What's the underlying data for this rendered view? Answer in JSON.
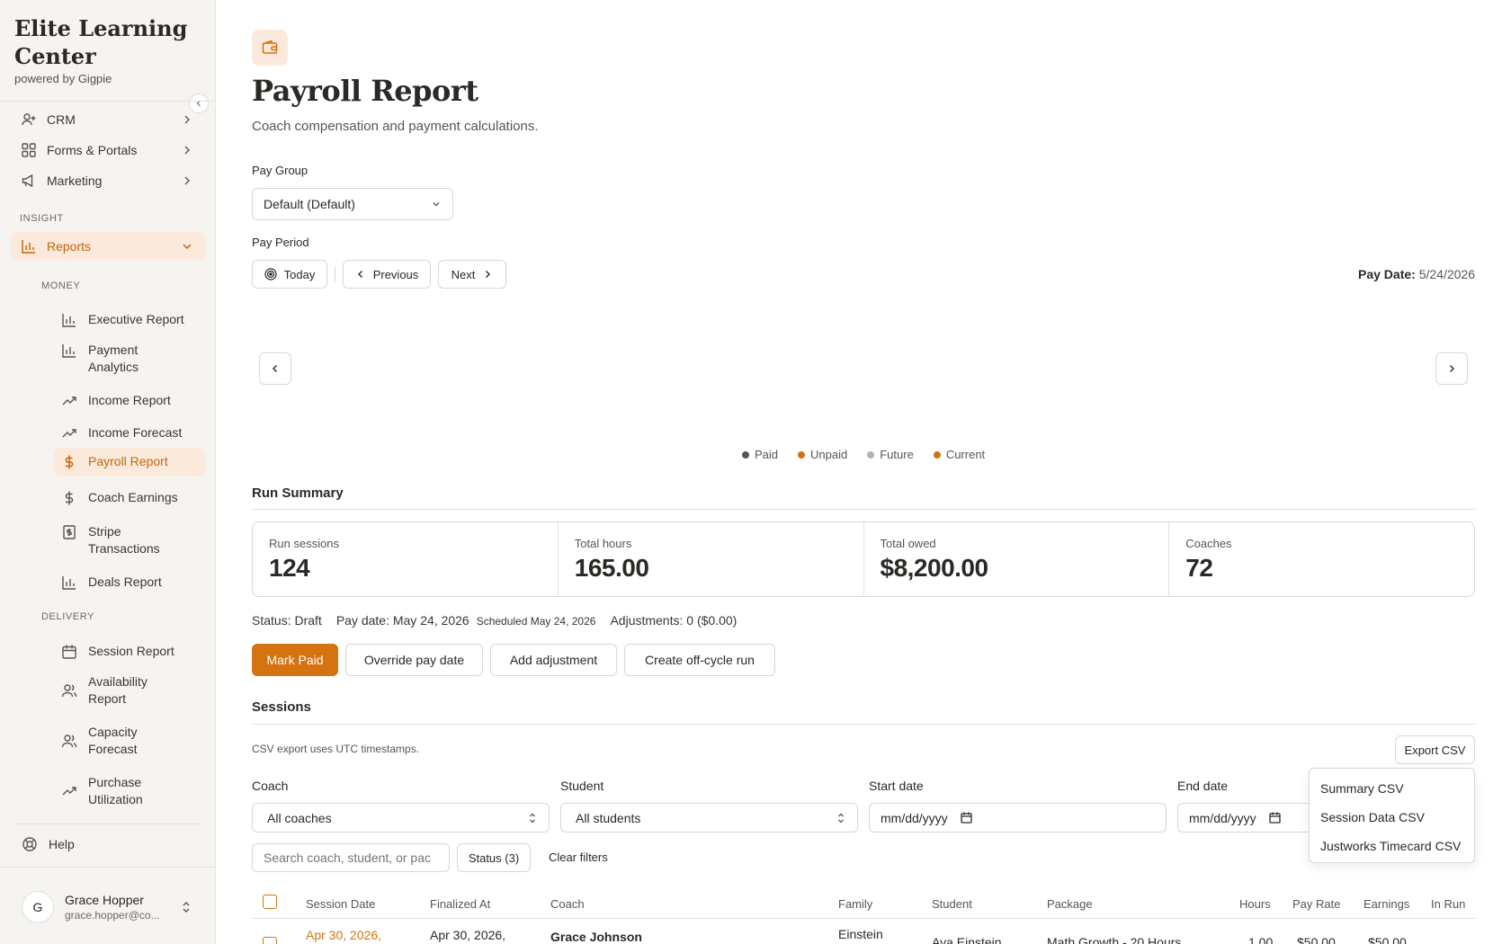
{
  "brand": {
    "name": "Elite Learning Center",
    "powered_by": "powered by Gigpie"
  },
  "nav": {
    "top_items": [
      {
        "label": "CRM",
        "icon": "user-plus-icon"
      },
      {
        "label": "Forms & Portals",
        "icon": "grid-icon"
      },
      {
        "label": "Marketing",
        "icon": "megaphone-icon"
      }
    ],
    "insight_label": "INSIGHT",
    "reports_label": "Reports",
    "money_label": "MONEY",
    "money_items": [
      {
        "label": "Executive Report",
        "icon": "bar-chart-icon"
      },
      {
        "label": "Payment Analytics",
        "icon": "bar-chart-icon"
      },
      {
        "label": "Income Report",
        "icon": "trending-up-icon"
      },
      {
        "label": "Income Forecast",
        "icon": "trending-up-icon"
      },
      {
        "label": "Payroll Report",
        "icon": "dollar-icon",
        "active": true
      },
      {
        "label": "Coach Earnings",
        "icon": "dollar-icon"
      },
      {
        "label": "Stripe Transactions",
        "icon": "receipt-icon"
      },
      {
        "label": "Deals Report",
        "icon": "bar-chart-icon"
      }
    ],
    "delivery_label": "DELIVERY",
    "delivery_items": [
      {
        "label": "Session Report",
        "icon": "calendar-icon"
      },
      {
        "label": "Availability Report",
        "icon": "users-icon"
      },
      {
        "label": "Capacity Forecast",
        "icon": "users-icon"
      },
      {
        "label": "Purchase Utilization",
        "icon": "trending-up-icon"
      }
    ],
    "help_label": "Help"
  },
  "user": {
    "initial": "G",
    "name": "Grace Hopper",
    "email": "grace.hopper@co..."
  },
  "page": {
    "title": "Payroll Report",
    "subtitle": "Coach compensation and payment calculations.",
    "pay_group_label": "Pay Group",
    "pay_group_value": "Default (Default)",
    "pay_period_label": "Pay Period",
    "today_label": "Today",
    "previous_label": "Previous",
    "next_label": "Next",
    "pay_date_label": "Pay Date:",
    "pay_date_value": "5/24/2026"
  },
  "legend": [
    {
      "label": "Paid",
      "color": "#5a554f"
    },
    {
      "label": "Unpaid",
      "color": "#d4730f"
    },
    {
      "label": "Future",
      "color": "#b5b0aa"
    },
    {
      "label": "Current",
      "color": "#d4730f"
    }
  ],
  "run_summary": {
    "title": "Run Summary",
    "stats": [
      {
        "label": "Run sessions",
        "value": "124"
      },
      {
        "label": "Total hours",
        "value": "165.00"
      },
      {
        "label": "Total owed",
        "value": "$8,200.00"
      },
      {
        "label": "Coaches",
        "value": "72"
      }
    ],
    "status": "Status: Draft",
    "pay_date": "Pay date: May 24, 2026",
    "scheduled": "Scheduled May 24, 2026",
    "adjustments": "Adjustments: 0 ($0.00)",
    "actions": {
      "mark_paid": "Mark Paid",
      "override_pay_date": "Override pay date",
      "add_adjustment": "Add adjustment",
      "create_off_cycle": "Create off-cycle run"
    }
  },
  "sessions": {
    "title": "Sessions",
    "csv_note": "CSV export uses UTC timestamps.",
    "export_label": "Export CSV",
    "export_menu": [
      "Summary CSV",
      "Session Data CSV",
      "Justworks Timecard CSV"
    ],
    "filters": {
      "coach_label": "Coach",
      "coach_value": "All coaches",
      "student_label": "Student",
      "student_value": "All students",
      "start_label": "Start date",
      "start_value": "mm/dd/yyyy",
      "end_label": "End date",
      "end_value": "mm/dd/yyyy",
      "search_placeholder": "Search coach, student, or pac",
      "status_label": "Status (3)",
      "clear_label": "Clear filters"
    },
    "columns": [
      "Session Date",
      "Finalized At",
      "Coach",
      "Family",
      "Student",
      "Package",
      "Hours",
      "Pay Rate",
      "Earnings",
      "In Run"
    ],
    "rows": [
      {
        "session_date": "Apr 30, 2026,",
        "finalized_at": "Apr 30, 2026,",
        "coach": "Grace Johnson",
        "family": "Einstein",
        "student": "Ava Einstein",
        "package": "Math Growth - 20 Hours",
        "hours": "1.00",
        "pay_rate": "$50.00",
        "earnings": "$50.00"
      }
    ]
  }
}
